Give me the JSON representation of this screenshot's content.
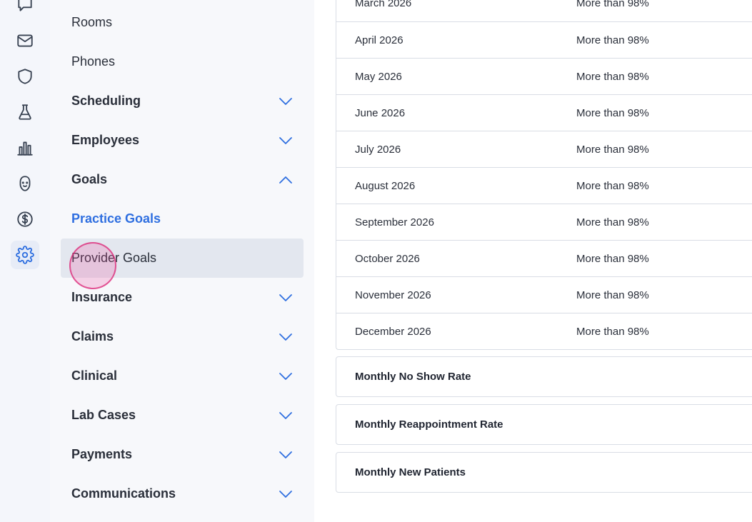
{
  "rail": {
    "items": [
      {
        "icon": "chat-bubble-icon",
        "active": false
      },
      {
        "icon": "mail-icon",
        "active": false
      },
      {
        "icon": "shield-icon",
        "active": false
      },
      {
        "icon": "flask-icon",
        "active": false
      },
      {
        "icon": "bar-chart-icon",
        "active": false
      },
      {
        "icon": "patient-icon",
        "active": false
      },
      {
        "icon": "dollar-circle-icon",
        "active": false
      },
      {
        "icon": "gear-icon",
        "active": true
      }
    ]
  },
  "nav": {
    "items": [
      {
        "label": "Rooms",
        "type": "sub"
      },
      {
        "label": "Phones",
        "type": "sub"
      },
      {
        "label": "Scheduling",
        "type": "section",
        "expanded": false
      },
      {
        "label": "Employees",
        "type": "section",
        "expanded": false
      },
      {
        "label": "Goals",
        "type": "section",
        "expanded": true
      },
      {
        "label": "Practice Goals",
        "type": "sub",
        "active": true
      },
      {
        "label": "Provider Goals",
        "type": "sub",
        "hover": true
      },
      {
        "label": "Insurance",
        "type": "section",
        "expanded": false
      },
      {
        "label": "Claims",
        "type": "section",
        "expanded": false
      },
      {
        "label": "Clinical",
        "type": "section",
        "expanded": false
      },
      {
        "label": "Lab Cases",
        "type": "section",
        "expanded": false
      },
      {
        "label": "Payments",
        "type": "section",
        "expanded": false
      },
      {
        "label": "Communications",
        "type": "section",
        "expanded": false
      }
    ]
  },
  "goals": {
    "rows": [
      {
        "month": "March 2026",
        "target": "More than 98%"
      },
      {
        "month": "April 2026",
        "target": "More than 98%"
      },
      {
        "month": "May 2026",
        "target": "More than 98%"
      },
      {
        "month": "June 2026",
        "target": "More than 98%"
      },
      {
        "month": "July 2026",
        "target": "More than 98%"
      },
      {
        "month": "August 2026",
        "target": "More than 98%"
      },
      {
        "month": "September 2026",
        "target": "More than 98%"
      },
      {
        "month": "October 2026",
        "target": "More than 98%"
      },
      {
        "month": "November 2026",
        "target": "More than 98%"
      },
      {
        "month": "December 2026",
        "target": "More than 98%"
      }
    ],
    "cards": [
      {
        "title": "Monthly No Show Rate"
      },
      {
        "title": "Monthly Reappointment Rate"
      },
      {
        "title": "Monthly New Patients"
      }
    ]
  },
  "colors": {
    "accent": "#2f6fe0",
    "rail_bg": "#f4f6fb",
    "nav_bg": "#f7f8fb",
    "border": "#d9dde5",
    "click_indicator": "#db2777"
  }
}
